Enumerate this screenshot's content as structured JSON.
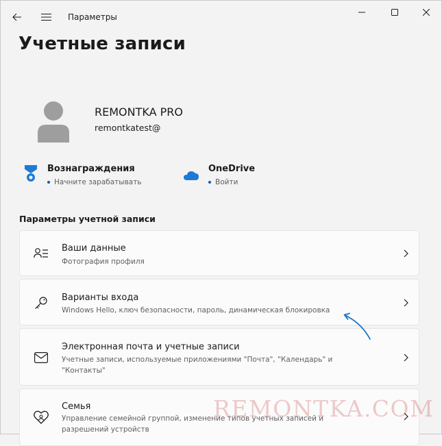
{
  "window": {
    "title": "Параметры"
  },
  "page": {
    "title": "Учетные записи"
  },
  "user": {
    "name": "REMONTKA PRO",
    "email": "remontkatest@"
  },
  "quick": [
    {
      "title": "Вознаграждения",
      "subtitle": "Начните зарабатывать",
      "icon": "rewards-icon"
    },
    {
      "title": "OneDrive",
      "subtitle": "Войти",
      "icon": "onedrive-icon"
    }
  ],
  "section": {
    "header": "Параметры учетной записи"
  },
  "items": [
    {
      "title": "Ваши данные",
      "desc": "Фотография профиля",
      "icon": "person-info-icon"
    },
    {
      "title": "Варианты входа",
      "desc": "Windows Hello, ключ безопасности, пароль, динамическая блокировка",
      "icon": "key-icon"
    },
    {
      "title": "Электронная почта и учетные записи",
      "desc": "Учетные записи, используемые приложениями \"Почта\", \"Календарь\" и \"Контакты\"",
      "icon": "mail-icon"
    },
    {
      "title": "Семья",
      "desc": "Управление семейной группой, изменение типов учетных записей и разрешений устройств",
      "icon": "family-heart-icon"
    }
  ],
  "watermark": "REMONTKA.COM",
  "colors": {
    "accent": "#005fb8",
    "annotation_arrow": "#1a73c9",
    "background": "#f3f3f3"
  }
}
